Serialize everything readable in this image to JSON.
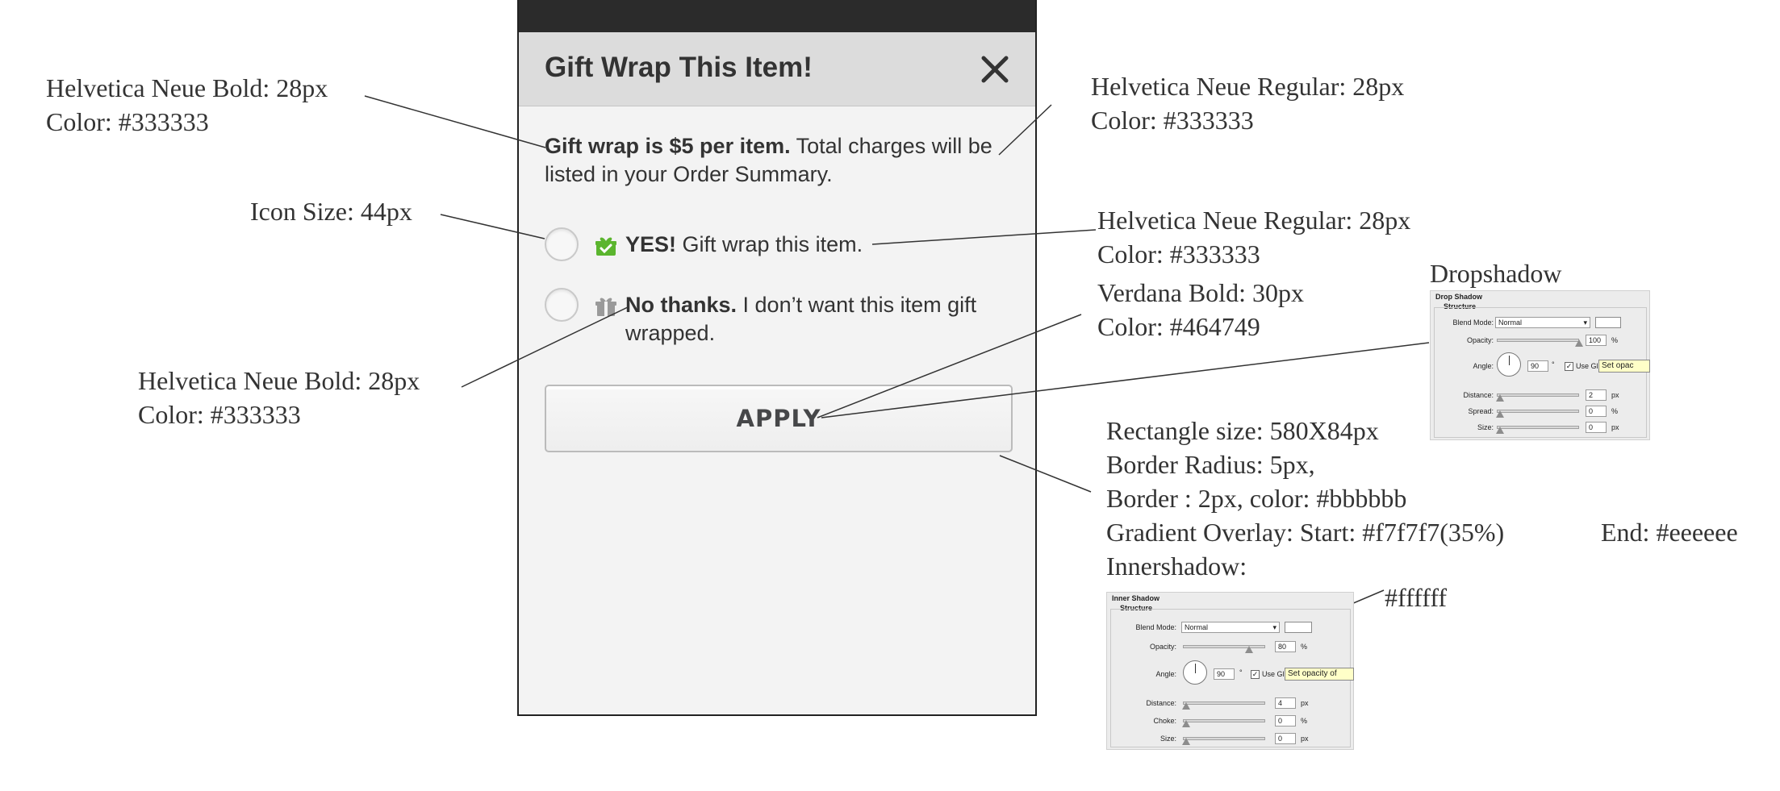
{
  "dialog": {
    "title": "Gift Wrap This Item!",
    "close_icon": "close-icon",
    "description_bold": "Gift wrap is $5 per item.",
    "description_rest": " Total charges will be listed in your Order Summary.",
    "option_yes": {
      "bold": "YES!",
      "rest": " Gift wrap this item.",
      "icon": "gift-icon",
      "icon_color": "#5bb52e"
    },
    "option_no": {
      "bold": "No thanks.",
      "rest": " I don’t want this item gift wrapped.",
      "icon": "gift-icon",
      "icon_color": "#9a9a9a"
    },
    "apply_label": "APPLY"
  },
  "annotations": {
    "title_font": {
      "line1": "Helvetica Neue Bold: 28px",
      "line2": "Color: #333333"
    },
    "icon_size": {
      "line1": "Icon Size: 44px"
    },
    "option_bold_font": {
      "line1": "Helvetica Neue Bold: 28px",
      "line2": "Color: #333333"
    },
    "desc_font": {
      "line1": "Helvetica Neue Regular: 28px",
      "line2": "Color: #333333"
    },
    "option_font": {
      "line1": "Helvetica Neue Regular: 28px",
      "line2": "Color: #333333"
    },
    "button_font": {
      "line1": "Verdana Bold: 30px",
      "line2": "Color: #464749"
    },
    "dropshadow": {
      "line1": "Dropshadow"
    },
    "button_spec": {
      "line1": "Rectangle size: 580X84px",
      "line2": "Border Radius: 5px,",
      "line3": "Border : 2px, color: #bbbbbb",
      "line4": "Gradient Overlay: Start: #f7f7f7(35%)",
      "line4_end": "End: #eeeeee",
      "line5": "Innershadow:"
    },
    "inner_shadow_color": {
      "line1": "#ffffff"
    }
  },
  "drop_shadow_panel": {
    "title": "Drop Shadow",
    "subtitle": "Structure",
    "blend_mode_label": "Blend Mode:",
    "blend_mode_value": "Normal",
    "opacity_label": "Opacity:",
    "opacity_value": "100",
    "opacity_unit": "%",
    "angle_label": "Angle:",
    "angle_value": "90",
    "angle_unit": "°",
    "global_light_label": "Use Gl",
    "tooltip": "Set opac",
    "distance_label": "Distance:",
    "distance_value": "2",
    "spread_label": "Spread:",
    "spread_value": "0",
    "size_label": "Size:",
    "size_value": "0",
    "px_unit": "px",
    "pct_unit": "%",
    "opacity_level": 1.0
  },
  "inner_shadow_panel": {
    "title": "Inner Shadow",
    "subtitle": "Structure",
    "blend_mode_label": "Blend Mode:",
    "blend_mode_value": "Normal",
    "opacity_label": "Opacity:",
    "opacity_value": "80",
    "opacity_unit": "%",
    "angle_label": "Angle:",
    "angle_value": "90",
    "angle_unit": "°",
    "global_light_label": "Use Gl",
    "tooltip": "Set opacity of",
    "distance_label": "Distance:",
    "distance_value": "4",
    "choke_label": "Choke:",
    "choke_value": "0",
    "size_label": "Size:",
    "size_value": "0",
    "px_unit": "px",
    "pct_unit": "%",
    "opacity_level": 0.8
  }
}
